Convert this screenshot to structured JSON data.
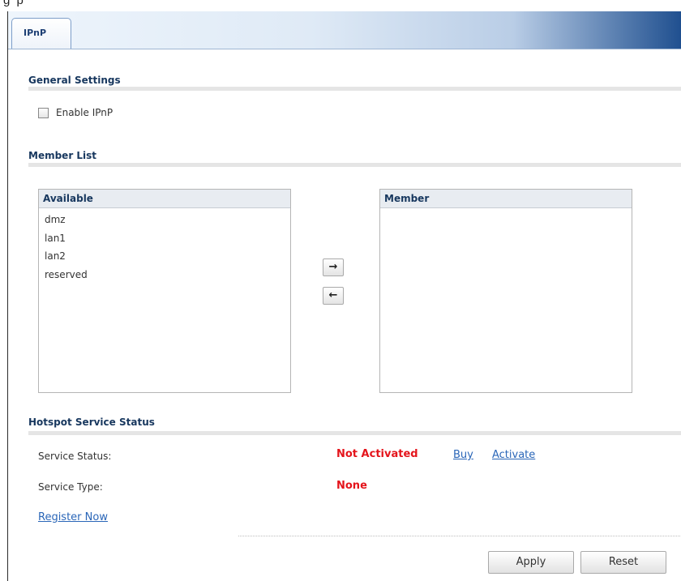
{
  "caption_fragment": "g                          p",
  "tabs": [
    {
      "label": "IPnP",
      "active": true
    }
  ],
  "general_settings": {
    "title": "General Settings",
    "enable_label": "Enable IPnP",
    "enable_checked": false
  },
  "member_list": {
    "title": "Member List",
    "available": {
      "header": "Available",
      "items": [
        "dmz",
        "lan1",
        "lan2",
        "reserved"
      ]
    },
    "member": {
      "header": "Member",
      "items": []
    },
    "add_arrow": "→",
    "remove_arrow": "←"
  },
  "hotspot": {
    "title": "Hotspot Service Status",
    "service_status_label": "Service Status:",
    "service_status_value": "Not Activated",
    "buy_link": "Buy",
    "activate_link": "Activate",
    "service_type_label": "Service Type:",
    "service_type_value": "None",
    "register_link": "Register Now"
  },
  "buttons": {
    "apply": "Apply",
    "reset": "Reset"
  },
  "colors": {
    "section_title": "#17375e",
    "status_red": "#e4141b",
    "link_blue": "#2a66b8",
    "tab_bar_dark": "#1f4f8f"
  }
}
